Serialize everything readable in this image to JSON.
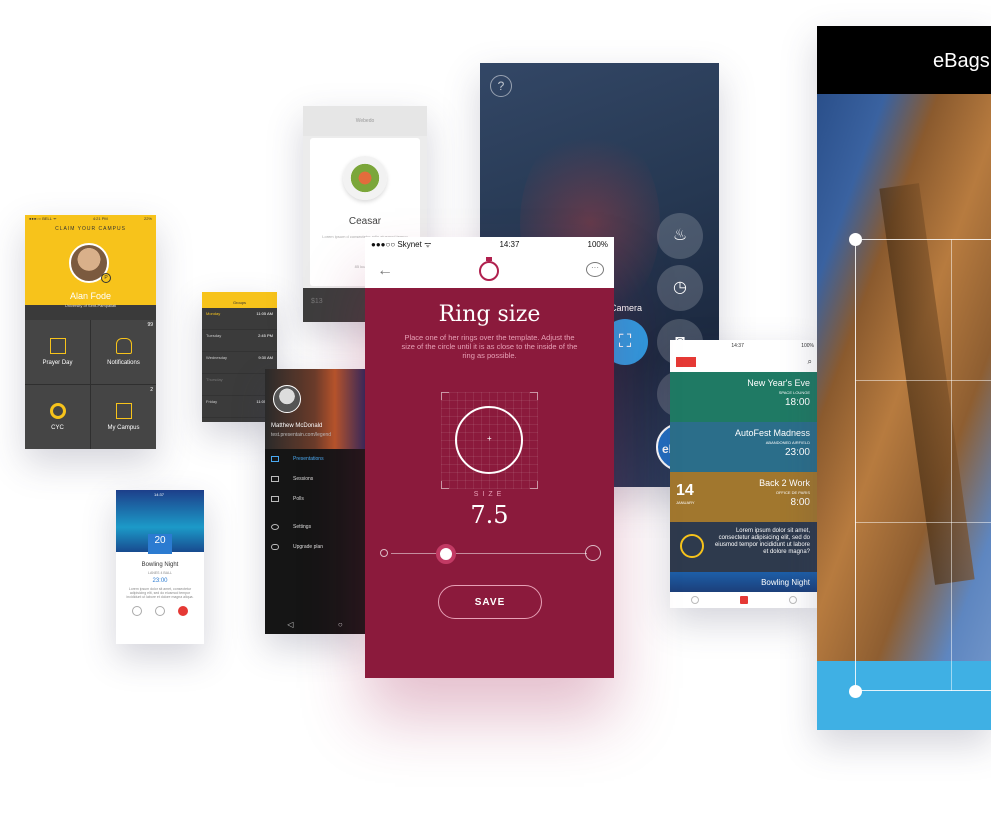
{
  "campus": {
    "status_left": "●●●○○ BELL ᯤ",
    "status_time": "4:21 PM",
    "status_right": "22%",
    "claim": "CLAIM YOUR CAMPUS",
    "badge": "P",
    "name": "Alan Fode",
    "university": "University of Sent-Pampaliati",
    "tiles": [
      {
        "label": "Prayer Day",
        "icon": "calendar-icon",
        "count": ""
      },
      {
        "label": "Notifications",
        "icon": "bell-icon",
        "count": "99"
      },
      {
        "label": "CYC",
        "icon": "ring-icon",
        "count": ""
      },
      {
        "label": "My Campus",
        "icon": "building-icon",
        "count": "2"
      }
    ]
  },
  "groups": {
    "title": "Groups",
    "rows": [
      {
        "day": "Monday",
        "note": "",
        "time": "11:05 AM"
      },
      {
        "day": "Tuesday",
        "note": "",
        "time": "2:45 PM"
      },
      {
        "day": "Wednesday",
        "note": "",
        "time": "9:30 AM"
      },
      {
        "day": "Thursday",
        "note": "",
        "time": ""
      },
      {
        "day": "Friday",
        "note": "",
        "time": "11:05 AM"
      }
    ]
  },
  "ceasar": {
    "nav_title": "Webedo",
    "title": "Ceasar",
    "lorem": "Lorem ipsum d consectetur adip eiusmod tempo",
    "meta": "85 kcal · 30",
    "price": "$13"
  },
  "drawer": {
    "name": "Matthew McDonald",
    "email": "test.presentain.com/legend",
    "items": [
      {
        "label": "Presentations",
        "active": true
      },
      {
        "label": "Sessions",
        "active": false
      },
      {
        "label": "Polls",
        "active": false
      },
      {
        "label": "Settings",
        "active": false
      },
      {
        "label": "Upgrade plan",
        "active": false
      }
    ],
    "nav": [
      "◁",
      "○"
    ]
  },
  "bowling": {
    "status_time": "14:37",
    "date": "20",
    "title": "Bowling Night",
    "subtitle": "LANES 4 BALL",
    "time": "23:00",
    "desc": "Lorem ipsum dolor sit amet, consectetur adipisicing elit, sed do eiusmod tempor incididunt ut labore et dolore magna aliqua."
  },
  "camera": {
    "help": "?",
    "label": "Camera",
    "brand": "eBags"
  },
  "events": {
    "status_time": "14:37",
    "status_right": "100%",
    "items": [
      {
        "name": "New Year's Eve",
        "sub": "SPACE LOUNGE",
        "time": "18:00",
        "day": "",
        "month": "",
        "bg": "#1f7a64"
      },
      {
        "name": "AutoFest Madness",
        "sub": "ABANDONED AIRFIELD",
        "time": "23:00",
        "day": "",
        "month": "",
        "bg": "#2b6e8a"
      },
      {
        "name": "Back 2 Work",
        "sub": "OFFICE DE PARIS",
        "time": "8:00",
        "day": "14",
        "month": "JANUARY",
        "bg": "#a1772e"
      }
    ],
    "lorem": "Lorem ipsum dolor sit amet, consectetur adipisicing elit, sed do eiusmod tempor incididunt ut labore et dolore magna?",
    "bowling": "Bowling Night"
  },
  "ebags": {
    "title": "eBags"
  },
  "ring": {
    "carrier": "●●●○○ Skynet ᯤ",
    "time": "14:37",
    "battery": "100%",
    "title": "Ring size",
    "subtitle": "Place one of her rings over the template. Adjust the size of the circle until it is as close to the inside of the ring as possible.",
    "size_label": "SIZE",
    "size_value": "7.5",
    "slider_level": 0.28,
    "save_label": "SAVE",
    "accent": "#8b1a3c"
  }
}
